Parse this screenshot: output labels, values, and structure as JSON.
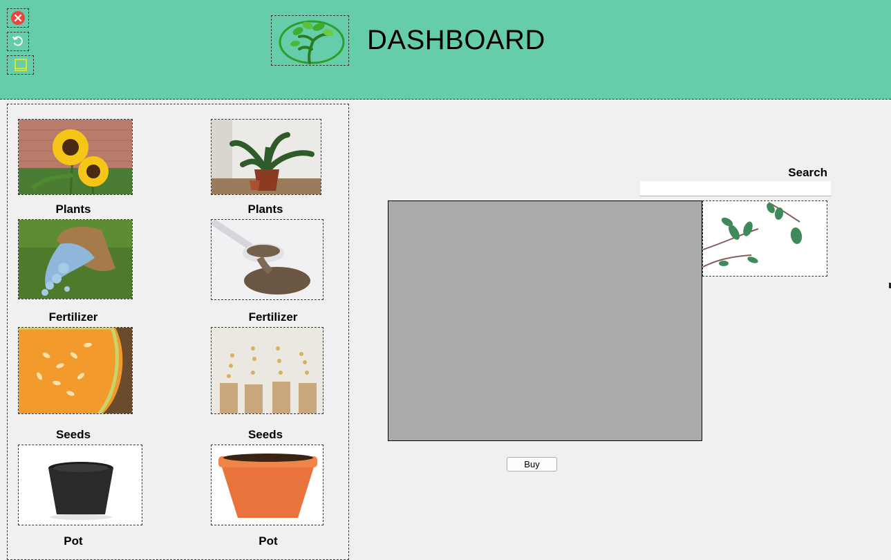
{
  "header": {
    "title": "DASHBOARD",
    "background": "#66cdaa"
  },
  "window_controls": [
    {
      "name": "close-icon",
      "color": "#e8453c"
    },
    {
      "name": "refresh-icon",
      "color": "#ffffff"
    },
    {
      "name": "minimize-icon",
      "color": "#ffea00"
    }
  ],
  "catalog": {
    "items": [
      {
        "label": "Plants",
        "image": "sunflower-image"
      },
      {
        "label": "Plants",
        "image": "potted-plant-image"
      },
      {
        "label": "Fertilizer",
        "image": "fertilizer-bag-image"
      },
      {
        "label": "Fertilizer",
        "image": "seed-spoon-image"
      },
      {
        "label": "Seeds",
        "image": "melon-seeds-image"
      },
      {
        "label": "Seeds",
        "image": "seed-bags-image"
      },
      {
        "label": "Pot",
        "image": "black-pot-image"
      },
      {
        "label": "Pot",
        "image": "terracotta-pot-image"
      }
    ]
  },
  "search": {
    "label": "Search",
    "value": ""
  },
  "buy_button": {
    "label": "Buy"
  }
}
